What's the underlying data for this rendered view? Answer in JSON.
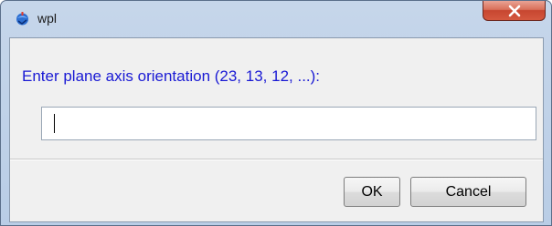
{
  "window": {
    "title": "wpl",
    "app_icon": "wpl-app-icon",
    "close_icon": "close-icon",
    "colors": {
      "frame": "#c6d6ea",
      "close_button": "#c74630",
      "prompt_text": "#1a1ad4"
    }
  },
  "dialog": {
    "prompt": "Enter plane axis orientation (23, 13, 12, ...):",
    "input_value": "",
    "ok_label": "OK",
    "cancel_label": "Cancel"
  }
}
